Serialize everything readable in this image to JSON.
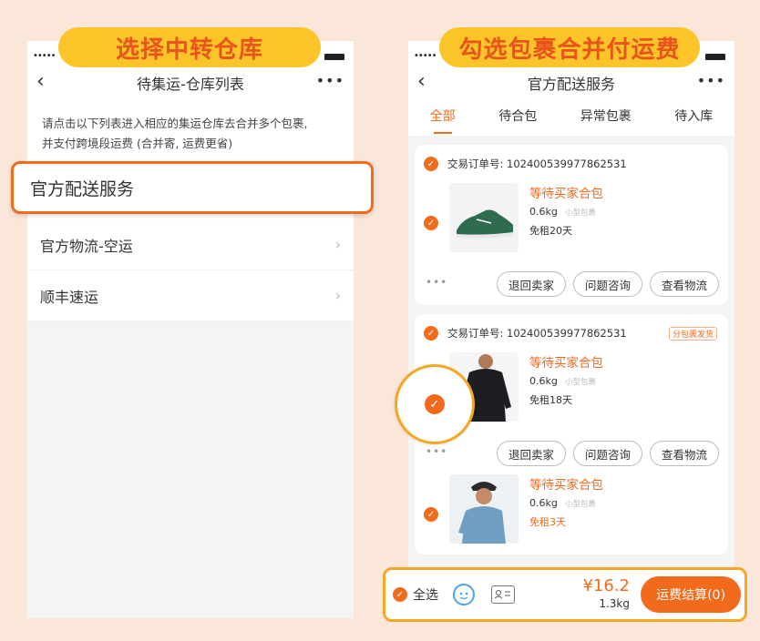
{
  "left": {
    "caption": "选择中转仓库",
    "signal": "•••••",
    "nav": {
      "back": "‹",
      "title": "待集运-仓库列表",
      "more": "•••"
    },
    "intro_lines": [
      "请点击以下列表进入相应的集运仓库去合并多个包裹,",
      "并支付跨境段运费 (合并寄, 运费更省)"
    ],
    "selected": "官方配送服务",
    "items": [
      {
        "label": "官方物流-空运",
        "chevron": "›"
      },
      {
        "label": "顺丰速运",
        "chevron": "›"
      }
    ]
  },
  "right": {
    "caption": "勾选包裹合并付运费",
    "signal": "•••••",
    "nav": {
      "back": "‹",
      "title": "官方配送服务",
      "more": "•••"
    },
    "tabs": [
      "全部",
      "待合包",
      "异常包裹",
      "待入库"
    ],
    "check_mark": "✓",
    "more_dots": "•••",
    "orders": [
      {
        "order_label": "交易订单号: 102400539977862531",
        "tag": "",
        "items": [
          {
            "status": "等待买家合包",
            "weight": "0.6kg",
            "size_tag": "小型包裹",
            "rent": "免租20天",
            "rent_highlight": false,
            "image": "green-sneaker"
          }
        ],
        "buttons": [
          "退回卖家",
          "问题咨询",
          "查看物流"
        ]
      },
      {
        "order_label": "交易订单号: 102400539977862531",
        "tag": "分包裹发货",
        "items": [
          {
            "status": "等待买家合包",
            "weight": "0.6kg",
            "size_tag": "小型包裹",
            "rent": "免租18天",
            "rent_highlight": false,
            "image": "black-shirt"
          },
          {
            "status": "等待买家合包",
            "weight": "0.6kg",
            "size_tag": "小型包裹",
            "rent": "免租3天",
            "rent_highlight": true,
            "image": "denim-shirt"
          }
        ],
        "buttons": [
          "退回卖家",
          "问题咨询",
          "查看物流"
        ]
      }
    ],
    "bottom": {
      "select_all": "全选",
      "price": "¥16.2",
      "weight": "1.3kg",
      "pay_button": "运费结算(0)"
    }
  },
  "colors": {
    "accent": "#f26a1c",
    "highlight": "#f5a623",
    "caption_bg": "#fbc52a",
    "background": "#fbe7da"
  }
}
